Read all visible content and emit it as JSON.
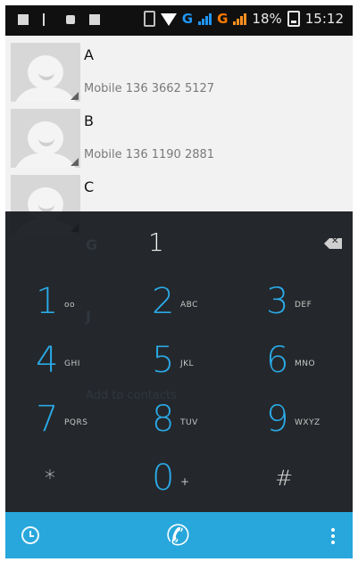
{
  "status_bar": {
    "battery_percent": "18%",
    "time": "15:12",
    "network_1": "G",
    "network_2": "G"
  },
  "contacts": [
    {
      "name": "A",
      "phone": "Mobile 136 3662 5127"
    },
    {
      "name": "B",
      "phone": "Mobile 136 1190 2881"
    },
    {
      "name": "C",
      "phone": ""
    }
  ],
  "faded_list": {
    "item_g": "G",
    "item_j": "J",
    "add_to_contacts": "Add to contacts"
  },
  "dialer": {
    "display_digits": "1",
    "keys": [
      {
        "number": "1",
        "letters": "oo"
      },
      {
        "number": "2",
        "letters": "ABC"
      },
      {
        "number": "3",
        "letters": "DEF"
      },
      {
        "number": "4",
        "letters": "GHI"
      },
      {
        "number": "5",
        "letters": "JKL"
      },
      {
        "number": "6",
        "letters": "MNO"
      },
      {
        "number": "7",
        "letters": "PQRS"
      },
      {
        "number": "8",
        "letters": "TUV"
      },
      {
        "number": "9",
        "letters": "WXYZ"
      },
      {
        "number": "*",
        "letters": ""
      },
      {
        "number": "0",
        "letters": "+"
      },
      {
        "number": "#",
        "letters": ""
      }
    ]
  },
  "colors": {
    "accent": "#2aa9e6",
    "bottom_bar": "#27a7db",
    "dialpad_bg": "#14181c"
  }
}
